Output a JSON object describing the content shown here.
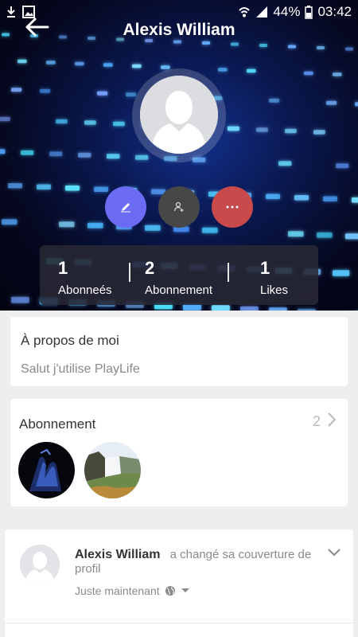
{
  "status_bar": {
    "battery": "44%",
    "time": "03:42"
  },
  "header": {
    "title": "Alexis William"
  },
  "stats": [
    {
      "value": "1",
      "label": "Abonneés"
    },
    {
      "value": "2",
      "label": "Abonnement"
    },
    {
      "value": "1",
      "label": "Likes"
    }
  ],
  "about": {
    "title": "À propos de moi",
    "text": "Salut j'utilise  PlayLife"
  },
  "following": {
    "title": "Abonnement",
    "count": "2"
  },
  "post": {
    "author": "Alexis William",
    "action": "a changé sa couverture de profil",
    "time": "Juste maintenant"
  },
  "colors": {
    "edit": "#6b6cf3",
    "user": "#474747",
    "more": "#c84a4b"
  }
}
